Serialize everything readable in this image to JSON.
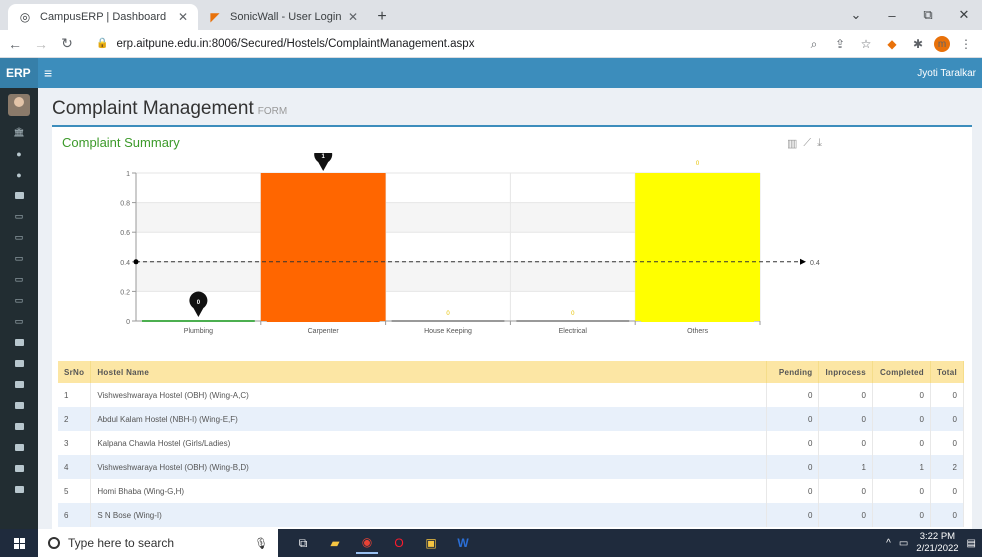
{
  "browser": {
    "tabs": [
      {
        "title": "CampusERP | Dashboard",
        "active": true
      },
      {
        "title": "SonicWall - User Login",
        "active": false
      }
    ],
    "new_tab": "+",
    "url": "erp.aitpune.edu.in:8006/Secured/Hostels/ComplaintManagement.aspx",
    "window_controls": [
      "⌄",
      "–",
      "⧉",
      "✕"
    ],
    "profile_initial": "m"
  },
  "app": {
    "brand": "ERP",
    "user_name": "Jyoti Taralkar"
  },
  "page": {
    "title": "Complaint Management",
    "subtitle": "FORM"
  },
  "summary": {
    "title": "Complaint Summary"
  },
  "chart_data": {
    "type": "bar",
    "categories": [
      "Plumbing",
      "Carpenter",
      "House Keeping",
      "Electrical",
      "Others"
    ],
    "values": [
      0,
      1,
      0,
      0,
      1
    ],
    "value_labels": [
      "0",
      "1",
      "0",
      "0",
      "0"
    ],
    "colors": [
      "#4caf50",
      "#ff6600",
      "#cccccc",
      "#cccccc",
      "#ffff00"
    ],
    "yticks": [
      "0",
      "0.2",
      "0.4",
      "0.6",
      "0.8",
      "1"
    ],
    "ylim": [
      0,
      1
    ],
    "average": 0.4,
    "average_label": "0.4",
    "max_marker": "1",
    "min_marker": "0"
  },
  "table": {
    "headers": [
      "SrNo",
      "Hostel Name",
      "Pending",
      "Inprocess",
      "Completed",
      "Total"
    ],
    "rows": [
      {
        "srno": "1",
        "name": "Vishweshwaraya Hostel (OBH) (Wing-A,C)",
        "pending": "0",
        "inprocess": "0",
        "completed": "0",
        "total": "0"
      },
      {
        "srno": "2",
        "name": "Abdul Kalam Hostel (NBH-I) (Wing-E,F)",
        "pending": "0",
        "inprocess": "0",
        "completed": "0",
        "total": "0"
      },
      {
        "srno": "3",
        "name": "Kalpana Chawla Hostel (Girls/Ladies)",
        "pending": "0",
        "inprocess": "0",
        "completed": "0",
        "total": "0"
      },
      {
        "srno": "4",
        "name": "Vishweshwaraya Hostel (OBH) (Wing-B,D)",
        "pending": "0",
        "inprocess": "1",
        "completed": "1",
        "total": "2"
      },
      {
        "srno": "5",
        "name": "Homi Bhaba (Wing-G,H)",
        "pending": "0",
        "inprocess": "0",
        "completed": "0",
        "total": "0"
      },
      {
        "srno": "6",
        "name": "S N Bose (Wing-I)",
        "pending": "0",
        "inprocess": "0",
        "completed": "0",
        "total": "0"
      }
    ]
  },
  "taskbar": {
    "search_placeholder": "Type here to search",
    "time": "3:22 PM",
    "date": "2/21/2022"
  }
}
